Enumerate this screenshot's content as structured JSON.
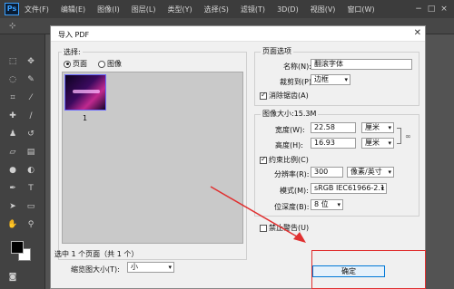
{
  "app": {
    "logo": "Ps",
    "menu": [
      "文件(F)",
      "编辑(E)",
      "图像(I)",
      "图层(L)",
      "类型(Y)",
      "选择(S)",
      "滤镜(T)",
      "3D(D)",
      "视图(V)",
      "窗口(W)"
    ],
    "window_controls": [
      "−",
      "□",
      "×"
    ]
  },
  "dialog": {
    "title": "导入 PDF",
    "select_group": {
      "legend": "选择:",
      "radio_page": "页面",
      "radio_image": "图像",
      "selected": "page"
    },
    "thumbnail": {
      "number": "1"
    },
    "status": "选中 1 个页面（共 1 个）",
    "thumb_size": {
      "label": "缩览图大小(T):",
      "value": "小"
    },
    "page_options": {
      "legend": "页面选项",
      "name_label": "名称(N):",
      "name_value": "翻滚字体",
      "crop_label": "裁剪到(P):",
      "crop_value": "边框",
      "antialias_label": "消除锯齿(A)",
      "antialias_checked": true
    },
    "image_size": {
      "legend": "图像大小:15.3M",
      "width_label": "宽度(W):",
      "width_value": "22.58",
      "width_unit": "厘米",
      "height_label": "高度(H):",
      "height_value": "16.93",
      "height_unit": "厘米",
      "constrain_label": "约束比例(C)",
      "constrain_checked": true,
      "resolution_label": "分辨率(R):",
      "resolution_value": "300",
      "resolution_unit": "像素/英寸",
      "mode_label": "模式(M):",
      "mode_value": "sRGB IEC61966-2.1",
      "bitdepth_label": "位深度(B):",
      "bitdepth_value": "8 位"
    },
    "suppress_label": "禁止警告(U)",
    "suppress_checked": false,
    "ok_label": "确定"
  },
  "colors": {
    "accent": "#0078d7",
    "annotation": "#e03030"
  }
}
